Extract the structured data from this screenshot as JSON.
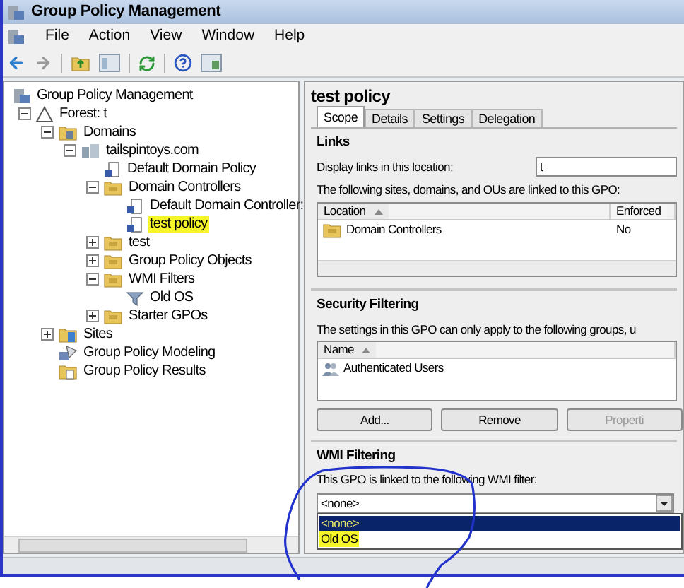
{
  "window": {
    "title": "Group Policy Management"
  },
  "menu": [
    "File",
    "Action",
    "View",
    "Window",
    "Help"
  ],
  "tree": [
    {
      "label": "Group Policy Management",
      "kind": "console",
      "highlighted": false,
      "children": [
        {
          "label": "Forest: t",
          "kind": "forest",
          "expanded": true,
          "highlighted": false,
          "children": [
            {
              "label": "Domains",
              "kind": "domains",
              "expanded": true,
              "highlighted": false,
              "children": [
                {
                  "label": "tailspintoys.com",
                  "kind": "domain",
                  "expanded": true,
                  "highlighted": false,
                  "children": [
                    {
                      "label": "Default Domain Policy",
                      "kind": "gpo",
                      "highlighted": false
                    },
                    {
                      "label": "Domain Controllers",
                      "kind": "folder",
                      "expanded": true,
                      "highlighted": false,
                      "children": [
                        {
                          "label": "Default Domain Controller:",
                          "kind": "gpo",
                          "highlighted": false
                        },
                        {
                          "label": "test policy",
                          "kind": "gpo",
                          "highlighted": true
                        }
                      ]
                    },
                    {
                      "label": "test",
                      "kind": "folder",
                      "expanded": false,
                      "highlighted": false
                    },
                    {
                      "label": "Group Policy Objects",
                      "kind": "folder",
                      "expanded": false,
                      "highlighted": false
                    },
                    {
                      "label": "WMI Filters",
                      "kind": "folder",
                      "expanded": true,
                      "highlighted": false,
                      "children": [
                        {
                          "label": "Old OS",
                          "kind": "filter",
                          "highlighted": false
                        }
                      ]
                    },
                    {
                      "label": "Starter GPOs",
                      "kind": "folder",
                      "expanded": false,
                      "highlighted": false
                    }
                  ]
                }
              ]
            },
            {
              "label": "Sites",
              "kind": "sites",
              "expanded": false,
              "highlighted": false
            },
            {
              "label": "Group Policy Modeling",
              "kind": "modeling",
              "highlighted": false
            },
            {
              "label": "Group Policy Results",
              "kind": "results",
              "highlighted": false
            }
          ]
        }
      ]
    }
  ],
  "details": {
    "title": "test policy",
    "tabs": [
      {
        "label": "Scope",
        "selected": true
      },
      {
        "label": "Details",
        "selected": false
      },
      {
        "label": "Settings",
        "selected": false
      },
      {
        "label": "Delegation",
        "selected": false
      }
    ],
    "links": {
      "title": "Links",
      "location_label": "Display links in this location:",
      "location_value": "t",
      "caption": "The following sites, domains, and OUs are linked to this GPO:",
      "columns": [
        {
          "label": "Location",
          "sorted": true
        },
        {
          "label": "Enforced",
          "sorted": false
        }
      ],
      "rows": [
        {
          "location": "Domain Controllers",
          "enforced": "No"
        }
      ]
    },
    "security": {
      "title": "Security Filtering",
      "caption": "The settings in this GPO can only apply to the following groups, u",
      "columns": [
        {
          "label": "Name",
          "sorted": true
        }
      ],
      "rows": [
        "Authenticated Users"
      ],
      "buttons": [
        {
          "label": "Add...",
          "disabled": false
        },
        {
          "label": "Remove",
          "disabled": false
        },
        {
          "label": "Properti",
          "disabled": true
        }
      ]
    },
    "wmi": {
      "title": "WMI Filtering",
      "caption": "This GPO is linked to the following WMI filter:",
      "value": "<none>",
      "options": [
        {
          "label": "<none>",
          "selected": true,
          "highlighted": false
        },
        {
          "label": "Old OS",
          "selected": false,
          "highlighted": true
        }
      ]
    }
  }
}
